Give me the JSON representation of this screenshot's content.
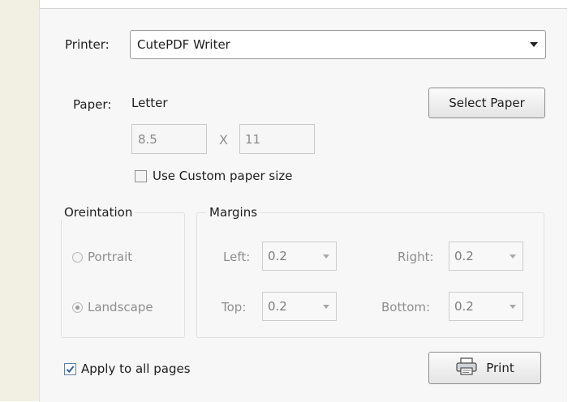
{
  "printer": {
    "label": "Printer:",
    "selected": "CutePDF Writer"
  },
  "paper": {
    "label": "Paper:",
    "name": "Letter",
    "select_button": "Select Paper",
    "width": "8.5",
    "separator": "X",
    "height": "11",
    "custom_size": {
      "label": "Use Custom paper size",
      "checked": false
    }
  },
  "orientation": {
    "title": "Oreintation",
    "options": [
      {
        "label": "Portrait",
        "selected": false
      },
      {
        "label": "Landscape",
        "selected": true
      }
    ]
  },
  "margins": {
    "title": "Margins",
    "left": {
      "label": "Left:",
      "value": "0.2"
    },
    "right": {
      "label": "Right:",
      "value": "0.2"
    },
    "top": {
      "label": "Top:",
      "value": "0.2"
    },
    "bottom": {
      "label": "Bottom:",
      "value": "0.2"
    }
  },
  "apply_all": {
    "label": "Apply to all pages",
    "checked": true
  },
  "print_button": {
    "label": "Print",
    "icon": "printer-icon"
  }
}
